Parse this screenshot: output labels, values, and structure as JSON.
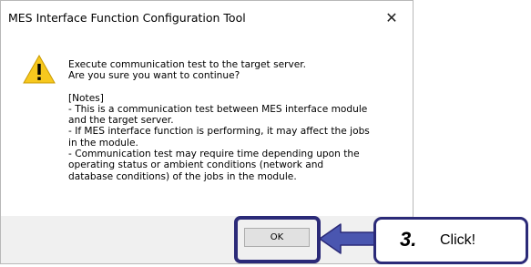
{
  "dialog": {
    "title": "MES Interface Function Configuration Tool",
    "close_icon": "close-icon",
    "icon": "warning-icon",
    "message_lines": [
      "Execute communication test to the target server.",
      "Are you sure you want to continue?",
      "",
      "[Notes]",
      "- This is a communication test between MES interface module",
      "and the target server.",
      "- If MES interface function is performing, it may affect the jobs",
      "in the module.",
      "- Communication test may require time depending upon the",
      "operating status or ambient conditions (network and",
      "database conditions) of the jobs in the module."
    ],
    "ok_label": "OK"
  },
  "annotation": {
    "step_number": "3.",
    "step_text": "Click!",
    "accent_color": "#2b2a78",
    "arrow_color": "#4a56b0"
  }
}
